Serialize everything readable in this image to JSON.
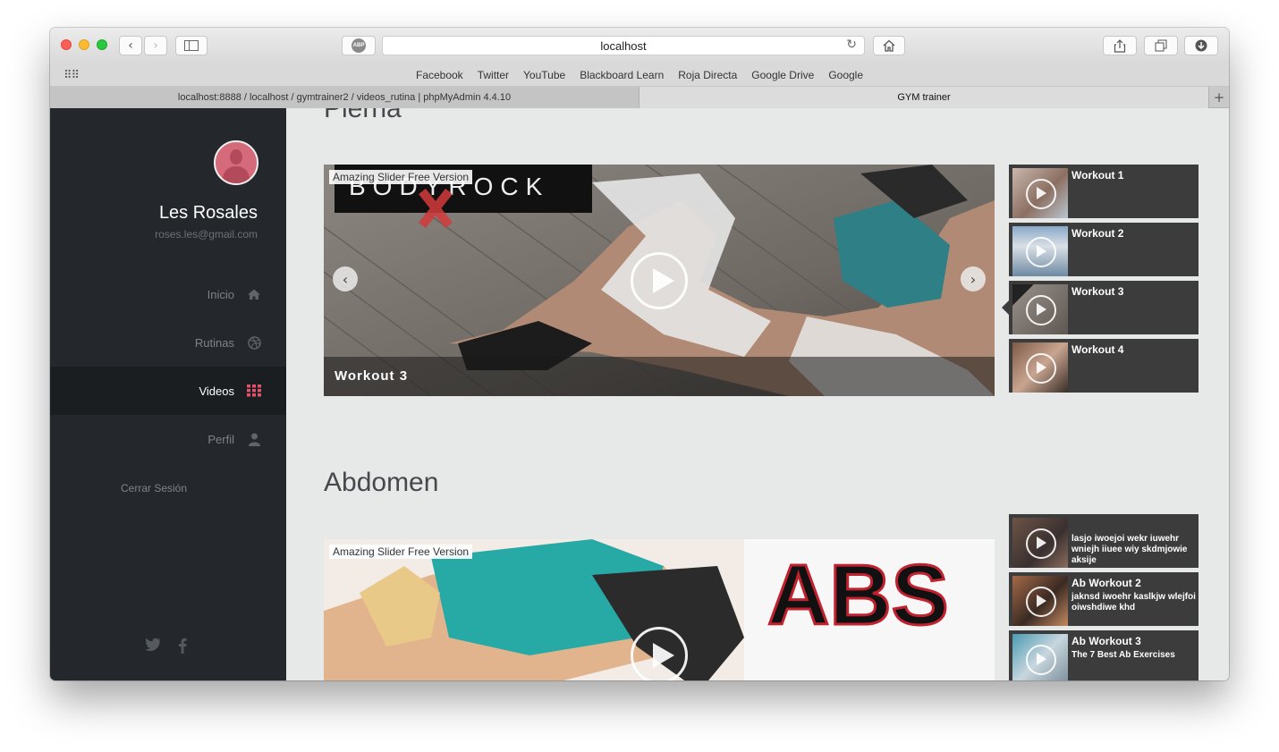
{
  "browser": {
    "address": "localhost",
    "abp_label": "ABP",
    "bookmarks": [
      "Facebook",
      "Twitter",
      "YouTube",
      "Blackboard Learn",
      "Roja Directa",
      "Google Drive",
      "Google"
    ],
    "tabs": [
      {
        "label": "localhost:8888 / localhost / gymtrainer2 / videos_rutina | phpMyAdmin 4.4.10",
        "active": false
      },
      {
        "label": "GYM trainer",
        "active": true
      }
    ],
    "new_tab": "+"
  },
  "sidebar": {
    "user_name": "Les Rosales",
    "user_email": "roses.les@gmail.com",
    "nav": [
      {
        "label": "Inicio",
        "icon": "home-icon",
        "active": false
      },
      {
        "label": "Rutinas",
        "icon": "dribbble-icon",
        "active": false
      },
      {
        "label": "Videos",
        "icon": "grid-icon",
        "active": true
      },
      {
        "label": "Perfil",
        "icon": "user-icon",
        "active": false
      }
    ],
    "logout": "Cerrar Sesión",
    "social": [
      "twitter-icon",
      "facebook-icon"
    ],
    "accent": "#e0516b"
  },
  "sections": [
    {
      "title": "Pierna",
      "watermark": "Amazing Slider Free Version",
      "caption": "Workout 3",
      "banner_text": "BODYROCK",
      "thumbs": [
        {
          "title": "Workout 1",
          "desc": ""
        },
        {
          "title": "Workout 2",
          "desc": ""
        },
        {
          "title": "Workout 3",
          "desc": "",
          "active": true
        },
        {
          "title": "Workout 4",
          "desc": ""
        }
      ]
    },
    {
      "title": "Abdomen",
      "watermark": "Amazing Slider Free Version",
      "banner_text": "ABS",
      "thumbs": [
        {
          "title": "",
          "desc": "lasjo iwoejoi wekr iuwehr wniejh iiuee wiy skdmjowie aksije"
        },
        {
          "title": "Ab Workout 2",
          "desc": "jaknsd iwoehr kaslkjw wlejfoi oiwshdiwe khd"
        },
        {
          "title": "Ab Workout 3",
          "desc": "The 7 Best Ab Exercises"
        }
      ]
    }
  ]
}
